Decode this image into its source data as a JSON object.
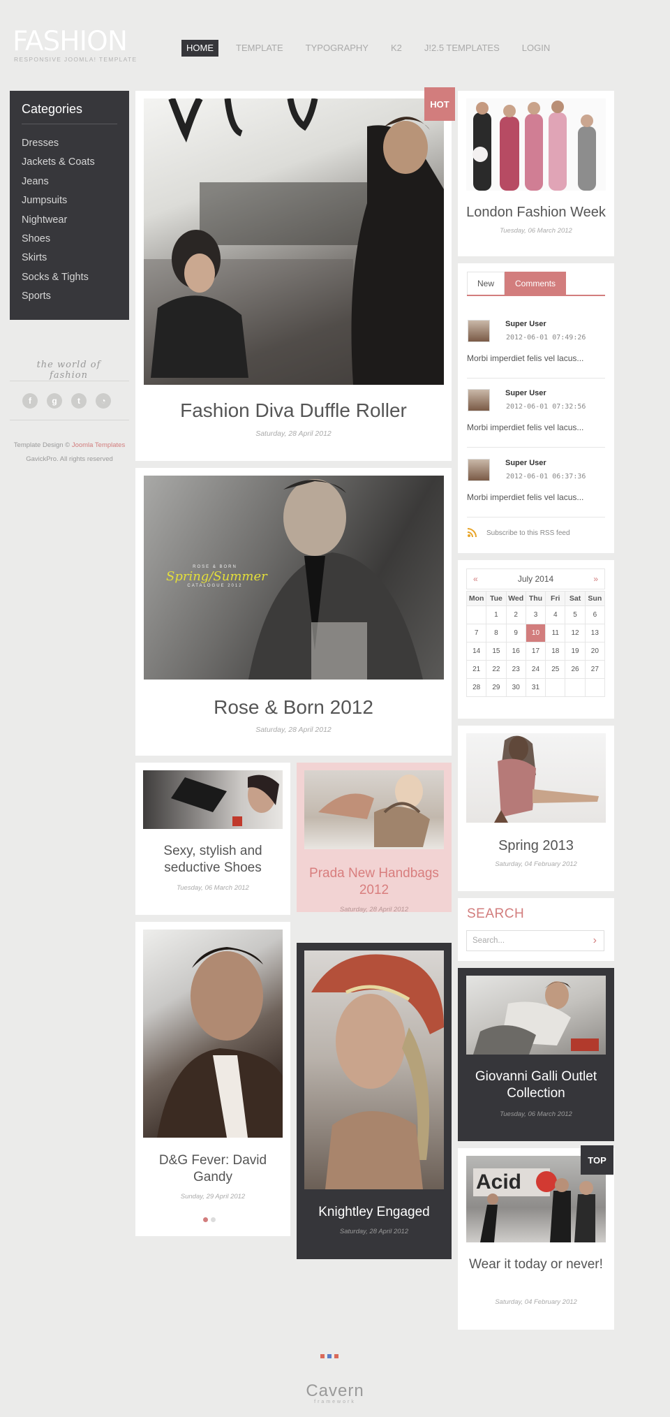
{
  "header": {
    "logo_title": "FASHION",
    "logo_subtitle": "RESPONSIVE JOOMLA! TEMPLATE",
    "nav": [
      "HOME",
      "TEMPLATE",
      "TYPOGRAPHY",
      "K2",
      "J!2.5 TEMPLATES",
      "LOGIN"
    ],
    "active_nav": "HOME"
  },
  "sidebar": {
    "categories_title": "Categories",
    "categories": [
      "Dresses",
      "Jackets & Coats",
      "Jeans",
      "Jumpsuits",
      "Nightwear",
      "Shoes",
      "Skirts",
      "Socks & Tights",
      "Sports"
    ],
    "tagline": "the world of fashion",
    "social_icons": [
      "facebook-icon",
      "googleplus-icon",
      "twitter-icon",
      "rss-icon"
    ],
    "social_glyphs": [
      "f",
      "g",
      "t",
      "◔"
    ],
    "credits_prefix": "Template Design ©",
    "credits_link": "Joomla Templates",
    "credits_line2": "GavickPro. All rights reserved"
  },
  "articles": {
    "main1": {
      "title": "Fashion Diva Duffle Roller",
      "date": "Saturday, 28 April 2012",
      "badge": "HOT"
    },
    "main2": {
      "title": "Rose & Born 2012",
      "date": "Saturday, 28 April 2012",
      "overlay_small": "ROSE & BORN",
      "overlay_big": "Spring/Summer",
      "overlay_small2": "CATALOGUE 2012"
    },
    "shoes": {
      "title": "Sexy, stylish and seductive Shoes",
      "date": "Tuesday, 06 March 2012"
    },
    "prada": {
      "title": "Prada New Handbags 2012",
      "date": "Saturday, 28 April 2012"
    },
    "dg": {
      "title": "D&G Fever: David Gandy",
      "date": "Sunday, 29 April 2012"
    },
    "knightley": {
      "title": "Knightley Engaged",
      "date": "Saturday, 28 April 2012"
    },
    "london": {
      "title": "London Fashion Week",
      "date": "Tuesday, 06 March 2012"
    },
    "spring": {
      "title": "Spring 2013",
      "date": "Saturday, 04 February 2012"
    },
    "giovanni": {
      "title": "Giovanni Galli Outlet Collection",
      "date": "Tuesday, 06 March 2012"
    },
    "wear": {
      "title": "Wear it today or never!",
      "date": "Saturday, 04 February 2012",
      "badge": "TOP",
      "image_text": "Acid"
    }
  },
  "comments_widget": {
    "tabs": [
      "New",
      "Comments"
    ],
    "active_tab": "Comments",
    "comments": [
      {
        "user": "Super User",
        "time": "2012-06-01 07:49:26",
        "text": "Morbi imperdiet felis vel lacus..."
      },
      {
        "user": "Super User",
        "time": "2012-06-01 07:32:56",
        "text": "Morbi imperdiet felis vel lacus..."
      },
      {
        "user": "Super User",
        "time": "2012-06-01 06:37:36",
        "text": "Morbi imperdiet felis vel lacus..."
      }
    ],
    "rss_label": "Subscribe to this RSS feed"
  },
  "calendar": {
    "prev": "«",
    "next": "»",
    "month": "July 2014",
    "weekdays": [
      "Mon",
      "Tue",
      "Wed",
      "Thu",
      "Fri",
      "Sat",
      "Sun"
    ],
    "leading_blanks": 1,
    "days_in_month": 31,
    "today": 10
  },
  "search": {
    "title": "SEARCH",
    "placeholder": "Search...",
    "button_glyph": "›"
  },
  "footer": {
    "logo": "Cavern",
    "logo_sub": "framework",
    "dot_colors": [
      "#d96a5a",
      "#5a7ec8",
      "#d96a5a"
    ]
  },
  "colors": {
    "accent": "#d27d7d",
    "dark": "#36363a",
    "background": "#ebebea"
  }
}
